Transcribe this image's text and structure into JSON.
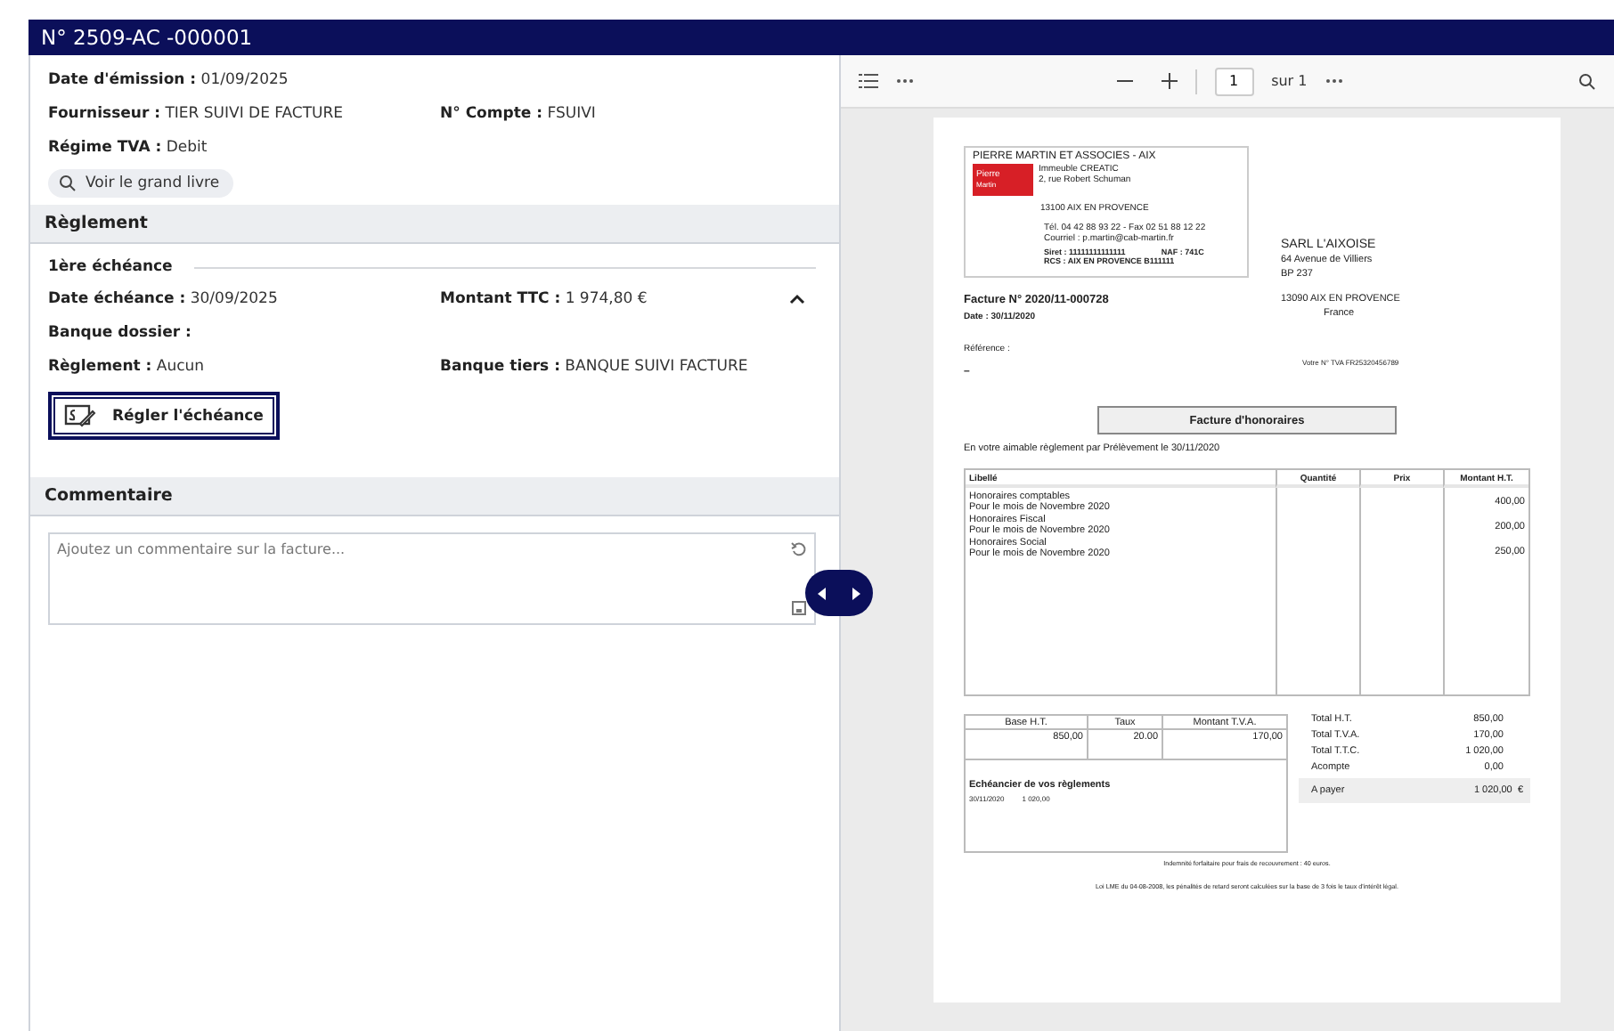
{
  "window": {
    "title": "N° 2509-AC -000001"
  },
  "info": [
    {
      "label": "Date d'émission :",
      "value": "01/09/2025"
    },
    {
      "label": "Fournisseur :",
      "value": "TIER SUIVI DE FACTURE"
    },
    {
      "label": "N° Compte :",
      "value": "FSUIVI"
    },
    {
      "label": "Régime TVA :",
      "value": "Debit"
    }
  ],
  "ledger_button": "Voir le grand livre",
  "payment": {
    "title": "Règlement",
    "installment": "1ère échéance",
    "expanded": true,
    "fields": [
      {
        "label": "Date échéance :",
        "value": "30/09/2025"
      },
      {
        "label": "Montant TTC :",
        "value": "1 974,80 €"
      },
      {
        "label": "Banque dossier :"
      },
      {
        "label": "Règlement :",
        "value": "Aucun"
      },
      {
        "label": "Banque tiers :",
        "value": "BANQUE SUIVI FACTURE"
      }
    ],
    "button": "Régler l'échéance"
  },
  "comment": {
    "title": "Commentaire",
    "placeholder": "Ajoutez un commentaire sur la facture..."
  },
  "viewer": {
    "page": "1",
    "of": "sur 1"
  },
  "document": {
    "sender": {
      "name": "PIERRE MARTIN ET ASSOCIES - AIX",
      "logo_text": "Pierre Martin",
      "address": [
        "Immeuble CREATIC",
        "2, rue Robert Schuman"
      ],
      "city": "13100 AIX EN PROVENCE",
      "contact": [
        "Tél.   04 42 88 93 22    - Fax  02 51 88 12 22",
        "Courriel : p.martin@cab-martin.fr"
      ],
      "ids": [
        [
          "Siret : 11111111111111",
          "NAF : 741C"
        ],
        [
          "RCS : AIX EN PROVENCE B111111"
        ]
      ]
    },
    "recipient": {
      "name": "SARL L'AIXOISE",
      "address": [
        "64 Avenue de Villiers",
        "BP 237"
      ],
      "city": "13090 AIX EN PROVENCE",
      "country": "France"
    },
    "invoice_number": "Facture N° 2020/11-000728",
    "date": "Date : 30/11/2020",
    "reference": "Référence :",
    "vat_number": "Votre N° TVA FR25320456789",
    "dash": "–",
    "title": "Facture d'honoraires",
    "intro": "En votre aimable règlement par Prélèvement le 30/11/2020",
    "columns": [
      "Libellé",
      "Quantité",
      "Prix",
      "Montant H.T."
    ],
    "lines": [
      {
        "label": "Honoraires comptables",
        "detail": "Pour le mois de Novembre 2020",
        "amount": "400,00"
      },
      {
        "label": "Honoraires Fiscal",
        "detail": "Pour le mois de Novembre 2020",
        "amount": "200,00"
      },
      {
        "label": "Honoraires Social",
        "detail": "Pour le mois de Novembre 2020",
        "amount": "250,00"
      }
    ],
    "tax_columns": [
      "Base H.T.",
      "Taux",
      "Montant T.V.A."
    ],
    "tax_row": [
      "850,00",
      "20.00",
      "170,00"
    ],
    "schedule_title": "Echéancier de vos règlements",
    "schedule": [
      [
        "30/11/2020",
        "1 020,00"
      ]
    ],
    "totals": [
      {
        "label": "Total H.T.",
        "value": "850,00",
        "highlight": false
      },
      {
        "label": "Total T.V.A.",
        "value": "170,00",
        "highlight": false
      },
      {
        "label": "Total T.T.C.",
        "value": "1 020,00",
        "highlight": false
      },
      {
        "label": "Acompte",
        "value": "0,00",
        "highlight": false
      },
      {
        "label": "A payer",
        "value": "1 020,00",
        "currency": "€",
        "highlight": true
      }
    ],
    "notes": [
      "Indemnité forfaitaire pour frais de recouvrement : 40 euros.",
      "Loi LME du 04-08-2008, les pénalités de retard seront calculées sur la base de 3 fois le taux d'intérêt légal."
    ]
  }
}
